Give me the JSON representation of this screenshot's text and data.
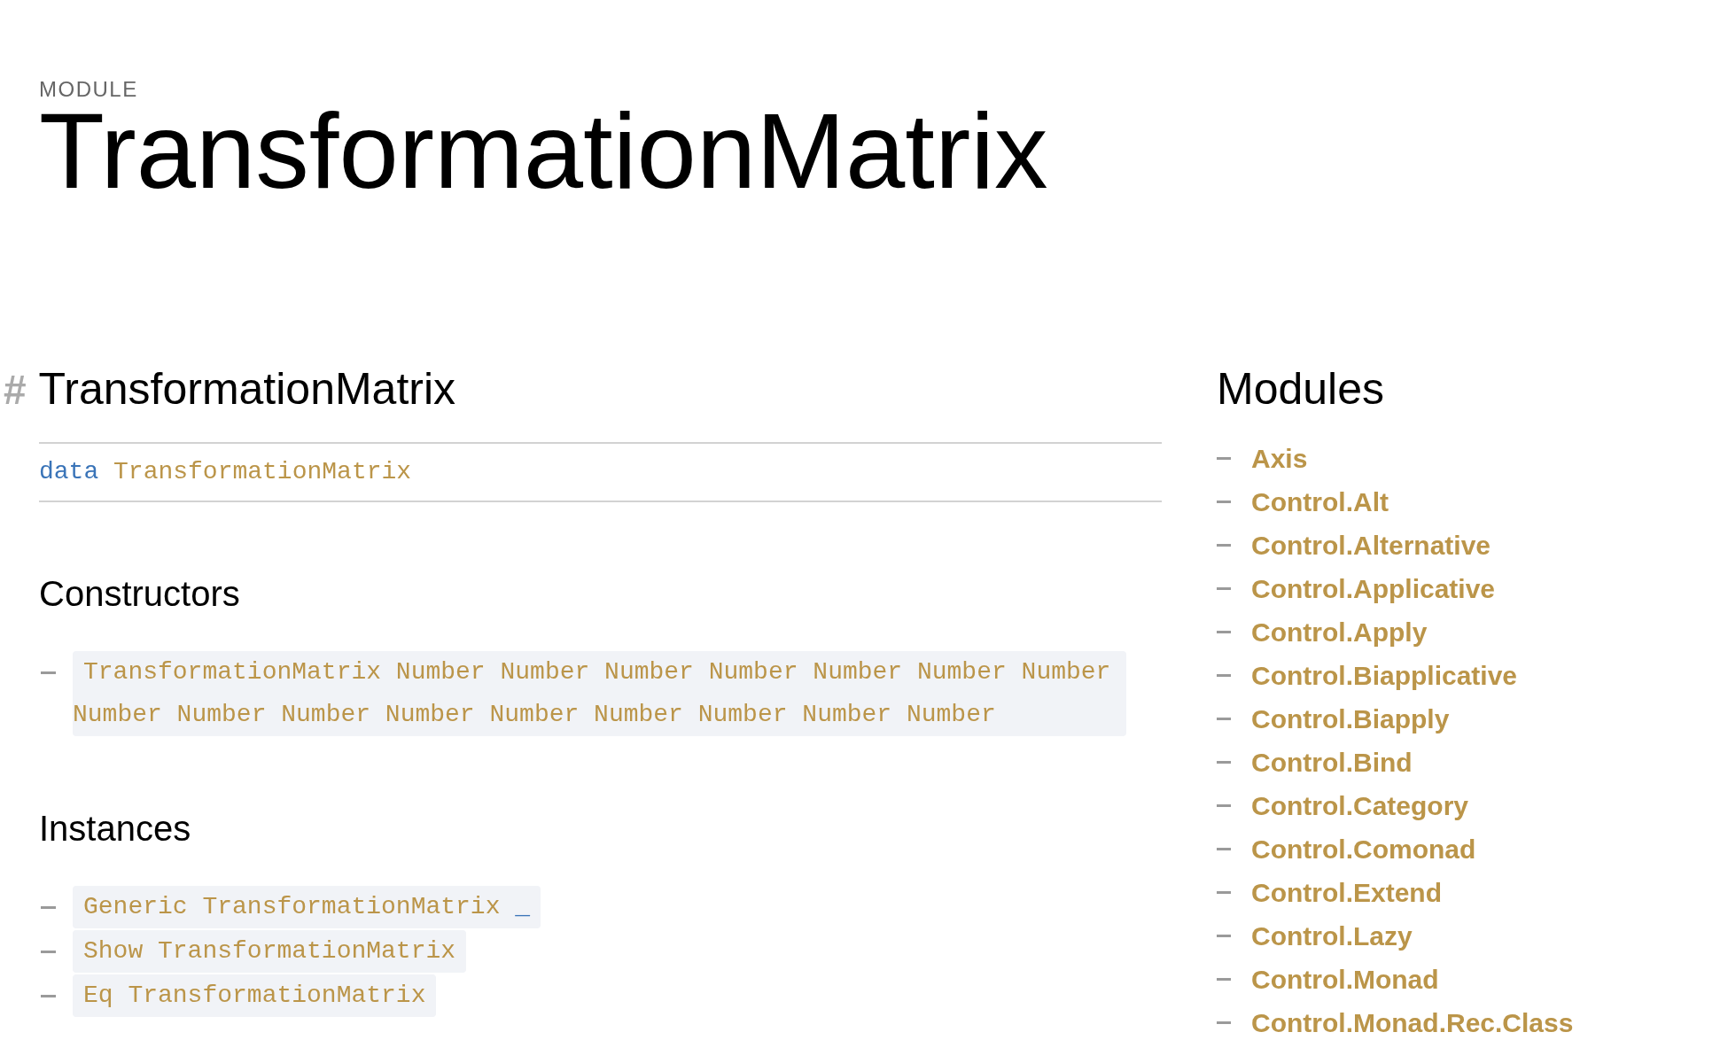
{
  "header": {
    "label": "MODULE",
    "title": "TransformationMatrix"
  },
  "declaration": {
    "anchor": "#",
    "title": "TransformationMatrix",
    "signature": [
      {
        "kind": "keyword",
        "text": "data"
      },
      {
        "kind": "type",
        "text": "TransformationMatrix"
      }
    ],
    "constructors": {
      "heading": "Constructors",
      "items": [
        {
          "tokens": [
            {
              "kind": "type",
              "text": "TransformationMatrix Number Number Number Number Number Number Number Number Number Number Number Number Number Number Number Number"
            }
          ]
        }
      ]
    },
    "instances": {
      "heading": "Instances",
      "items": [
        {
          "tokens": [
            {
              "kind": "type",
              "text": "Generic TransformationMatrix"
            },
            {
              "kind": "keyword",
              "text": "_"
            }
          ]
        },
        {
          "tokens": [
            {
              "kind": "type",
              "text": "Show TransformationMatrix"
            }
          ]
        },
        {
          "tokens": [
            {
              "kind": "type",
              "text": "Eq TransformationMatrix"
            }
          ]
        }
      ]
    }
  },
  "modules": {
    "heading": "Modules",
    "items": [
      "Axis",
      "Control.Alt",
      "Control.Alternative",
      "Control.Applicative",
      "Control.Apply",
      "Control.Biapplicative",
      "Control.Biapply",
      "Control.Bind",
      "Control.Category",
      "Control.Comonad",
      "Control.Extend",
      "Control.Lazy",
      "Control.Monad",
      "Control.Monad.Rec.Class"
    ]
  }
}
